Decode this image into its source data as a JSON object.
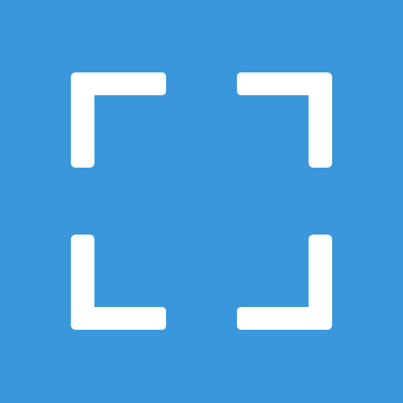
{
  "icon": {
    "name": "fullscreen-icon",
    "background_color": "#3a97db",
    "stroke_color": "#ffffff"
  }
}
